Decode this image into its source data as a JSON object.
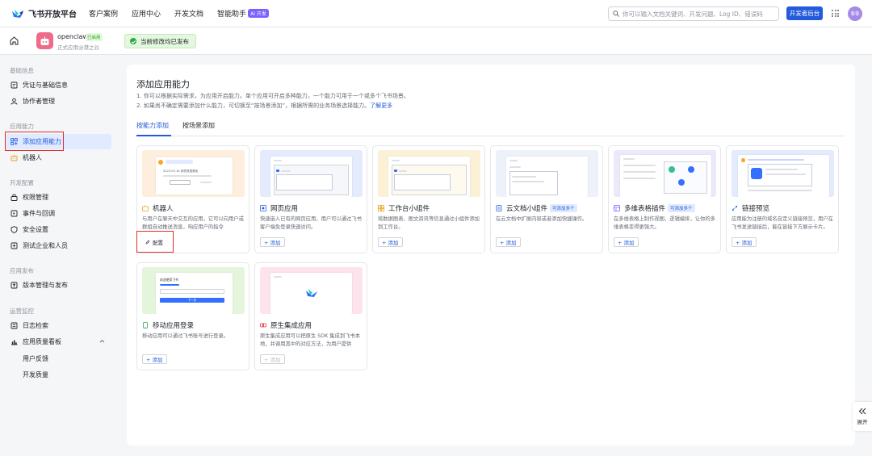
{
  "topnav": {
    "logo_text": "飞书开放平台",
    "links": [
      "客户案例",
      "应用中心",
      "开发文档",
      "智能助手"
    ],
    "ai_badge": "AI 开发",
    "search_placeholder": "你可以输入文档关键词、开发问题、Log ID、错误码",
    "dev_console": "开发者后台",
    "avatar_text": "筝筝"
  },
  "app": {
    "name": "openclaw",
    "status": "已启用",
    "subtitle": "正式应用@港之谷",
    "publish_notice": "当前修改均已发布"
  },
  "sidebar": {
    "groups": [
      {
        "title": "基础信息",
        "items": [
          "凭证与基础信息",
          "协作者管理"
        ]
      },
      {
        "title": "应用能力",
        "items": [
          "添加应用能力",
          "机器人"
        ]
      },
      {
        "title": "开发配置",
        "items": [
          "权限管理",
          "事件与回调",
          "安全设置",
          "测试企业和人员"
        ]
      },
      {
        "title": "应用发布",
        "items": [
          "版本管理与发布"
        ]
      },
      {
        "title": "运营监控",
        "items": [
          "日志检索",
          "应用质量看板"
        ]
      }
    ],
    "subitems": [
      "用户反馈",
      "开发质量"
    ],
    "active": "添加应用能力"
  },
  "main": {
    "title": "添加应用能力",
    "desc1": "1. 你可以根据实际需求，为应用开启能力。单个应用可开启多种能力，一个能力可用于一个或多个飞书场景。",
    "desc2": "2. 如果尚不确定需要添加什么能力，可切换至“按场景添加”，根据所需的业务场景选择能力。",
    "learn_more": "了解更多",
    "tabs": [
      "按能力添加",
      "按场景添加"
    ],
    "active_tab": "按能力添加",
    "cards": [
      {
        "title": "机器人",
        "desc": "与用户在聊天中交互的应用，它可以向用户或群组自动推送消息，响应用户的指令",
        "button": "配置",
        "badge": ""
      },
      {
        "title": "网页应用",
        "desc": "快速嵌入已有的网页应用，用户可以通过飞书客户端免登录快速访问。",
        "button": "+ 添加",
        "badge": ""
      },
      {
        "title": "工作台小组件",
        "desc": "将数据图表、图文资讯等信息通过小组件添加到工作台。",
        "button": "+ 添加",
        "badge": ""
      },
      {
        "title": "云文档小组件",
        "desc": "在云文档中扩展内容或者添加快捷操作。",
        "button": "+ 添加",
        "badge": "可添加多个"
      },
      {
        "title": "多维表格插件",
        "desc": "在多维表格上制作视图、逻辑编排，让你的多维表格变得更强大。",
        "button": "+ 添加",
        "badge": "可添加多个"
      },
      {
        "title": "链接预览",
        "desc": "应用能为注册的域名自定义链接预览，用户在飞书发送链接后，能在链接下方展示卡片。",
        "button": "+ 添加",
        "badge": ""
      },
      {
        "title": "移动应用登录",
        "desc": "移动应用可以通过飞书账号进行登录。",
        "button": "+ 添加",
        "badge": ""
      },
      {
        "title": "原生集成应用",
        "desc": "原生集成应用可以把原生 SDK 集成到飞书本地，并调用其中的对应方法，为用户提供",
        "button": "+ 添加",
        "badge": ""
      }
    ]
  },
  "thumb": {
    "login_title": "欢迎使用飞书",
    "login_btn": "下一步",
    "bot_date": "2023.05.18 销售数据看板"
  },
  "expand_label": "展开",
  "colors": {
    "brand": "#245bdb",
    "active_bg": "#e1eaff",
    "highlight": "#e22e28",
    "success": "#32a645"
  }
}
